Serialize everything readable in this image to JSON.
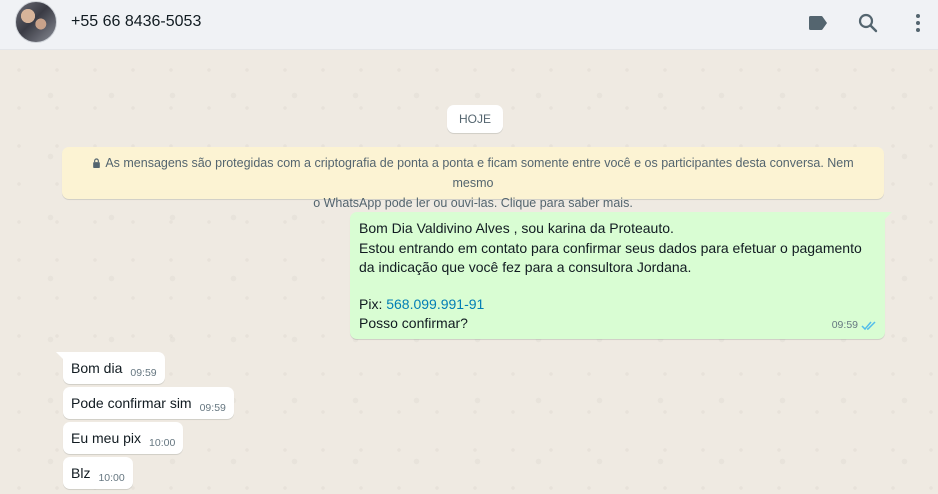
{
  "header": {
    "contact_name": "+55 66 8436-5053",
    "icons": [
      "label-icon",
      "search-icon",
      "menu-icon"
    ]
  },
  "chat": {
    "date_pill": "HOJE",
    "encryption_notice_line1": "As mensagens são protegidas com a criptografia de ponta a ponta e ficam somente entre você e os participantes desta conversa. Nem mesmo",
    "encryption_notice_line2": "o WhatsApp pode ler ou ouvi-las. Clique para saber mais.",
    "outgoing": {
      "line1": "Bom Dia Valdivino Alves , sou karina da Proteauto.",
      "line2": "Estou entrando em contato para confirmar seus dados para efetuar o pagamento",
      "line3": "da indicação que você fez para a consultora Jordana.",
      "pix_label": "Pix: ",
      "pix_value": "568.099.991-91",
      "line5": "Posso confirmar?",
      "time": "09:59",
      "status": "read"
    },
    "incoming": [
      {
        "text": "Bom dia",
        "time": "09:59"
      },
      {
        "text": "Pode confirmar sim",
        "time": "09:59"
      },
      {
        "text": "Eu meu pix",
        "time": "10:00"
      },
      {
        "text": "Blz",
        "time": "10:00"
      }
    ]
  },
  "colors": {
    "header_bg": "#f0f2f5",
    "chat_bg": "#efeae2",
    "outgoing_bubble": "#d9fdd3",
    "incoming_bubble": "#ffffff",
    "encryption_bg": "#fcf3d3",
    "read_ticks": "#53bdeb",
    "link": "#027eb5"
  }
}
